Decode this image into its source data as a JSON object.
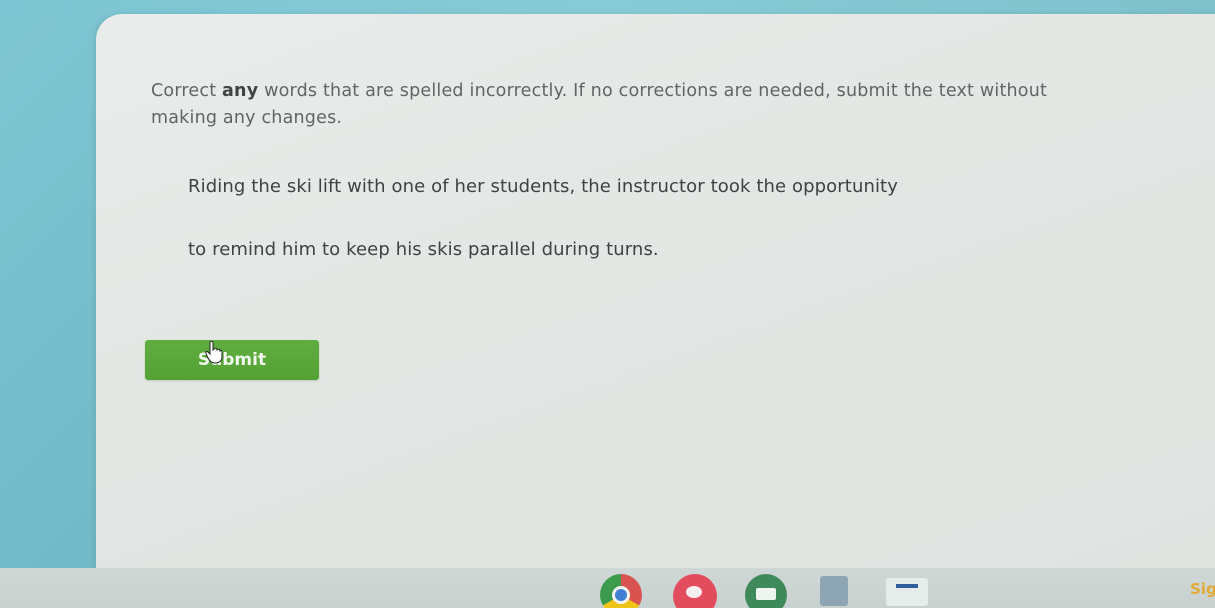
{
  "question": {
    "instruction_prefix": "Correct ",
    "instruction_emphasis": "any",
    "instruction_suffix": " words that are spelled incorrectly. If no corrections are needed, submit the text without making any changes.",
    "passage_line1": "Riding the ski lift with one of her students, the instructor took the opportunity",
    "passage_line2": "to remind him to keep his skis parallel during turns.",
    "submit_label": "Submit"
  },
  "shelf": {
    "apps": [
      "chrome-icon",
      "palette-icon",
      "classroom-icon",
      "square-app-icon",
      "docs-app-icon"
    ],
    "status_text": "Sig"
  },
  "colors": {
    "submit_button": "#56a536",
    "panel_background": "#e5e8e6",
    "desktop_background": "#72bac8"
  }
}
